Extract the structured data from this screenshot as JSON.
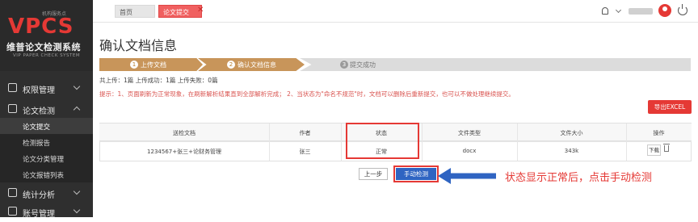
{
  "sidebar": {
    "logo_small": "机构服务点",
    "logo_main": "VPCS",
    "logo_cn": "维普论文检测系统",
    "logo_en": "VIP PAPER CHECK SYSTEM",
    "groups": [
      {
        "label": "权限管理"
      },
      {
        "label": "论文检测",
        "items": [
          {
            "label": "论文提交"
          },
          {
            "label": "检测报告"
          },
          {
            "label": "论文分类管理"
          },
          {
            "label": "论文报错列表"
          }
        ]
      },
      {
        "label": "统计分析"
      },
      {
        "label": "账号管理"
      }
    ]
  },
  "topbar": {
    "tabs": [
      {
        "label": "首页"
      },
      {
        "label": "论文提交"
      }
    ],
    "close_glyph": "✕"
  },
  "main": {
    "title": "确认文档信息",
    "steps": [
      {
        "num": "1",
        "label": "上传文档"
      },
      {
        "num": "2",
        "label": "确认文档信息"
      },
      {
        "num": "3",
        "label": "提交成功"
      }
    ],
    "stats": "共上传：1篇    上传成功：1篇    上传失败：0篇",
    "tip": "提示：1、页面刷新为正常现象，在刷新解析结果直到全部解析完成；  2、当状态为\"命名不规范\"时，文档可以删除后重新提交，也可以不做处理继续提交。",
    "export_label": "导出EXCEL",
    "table": {
      "headers": [
        "送检文档",
        "作者",
        "状态",
        "文件类型",
        "文件大小",
        "操作"
      ],
      "rows": [
        {
          "doc": "1234567+张三+论财务管理",
          "author": "张三",
          "status": "正常",
          "type": "docx",
          "size": "343k",
          "action": "下载"
        }
      ]
    },
    "prev_label": "上一步",
    "manual_label": "手动检测",
    "annotation": "状态显示正常后，点击手动检测"
  },
  "colors": {
    "accent": "#e53935",
    "step_active": "#c8955a",
    "primary_btn": "#2f64c2"
  }
}
